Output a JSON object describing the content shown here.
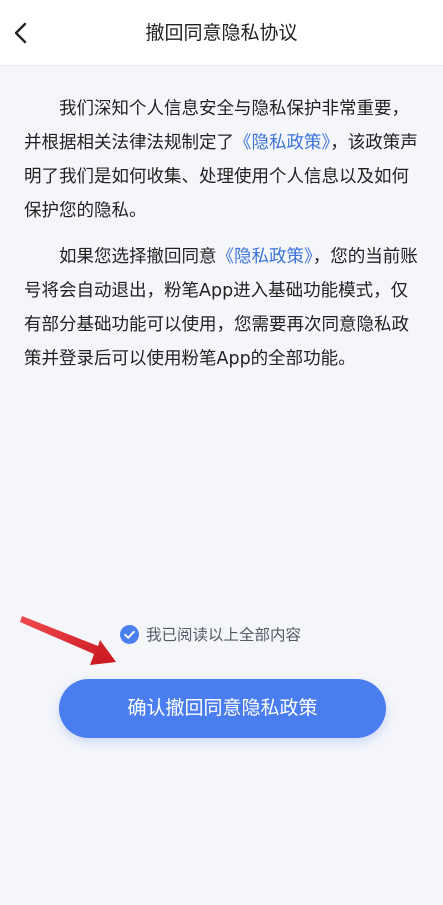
{
  "header": {
    "title": "撤回同意隐私协议"
  },
  "content": {
    "para1": {
      "before": "我们深知个人信息安全与隐私保护非常重要，并根据相关法律法规制定了",
      "link": "《隐私政策》",
      "after": "，该政策声明了我们是如何收集、处理使用个人信息以及如何保护您的隐私。"
    },
    "para2": {
      "before": "如果您选择撤回同意",
      "link": "《隐私政策》",
      "after": "，您的当前账号将会自动退出，粉笔App进入基础功能模式，仅有部分基础功能可以使用，您需要再次同意隐私政策并登录后可以使用粉笔App的全部功能。"
    }
  },
  "agreement": {
    "label": "我已阅读以上全部内容",
    "checked": true
  },
  "confirm_button": {
    "label": "确认撤回同意隐私政策"
  },
  "colors": {
    "accent": "#4a7df0",
    "link": "#3c74d8",
    "checkbox": "#4a80ee",
    "annotation_arrow": "#e8232a"
  },
  "icons": {
    "back": "chevron-left-icon",
    "checkbox": "check-circle-icon",
    "annotation": "red-arrow-annotation"
  }
}
